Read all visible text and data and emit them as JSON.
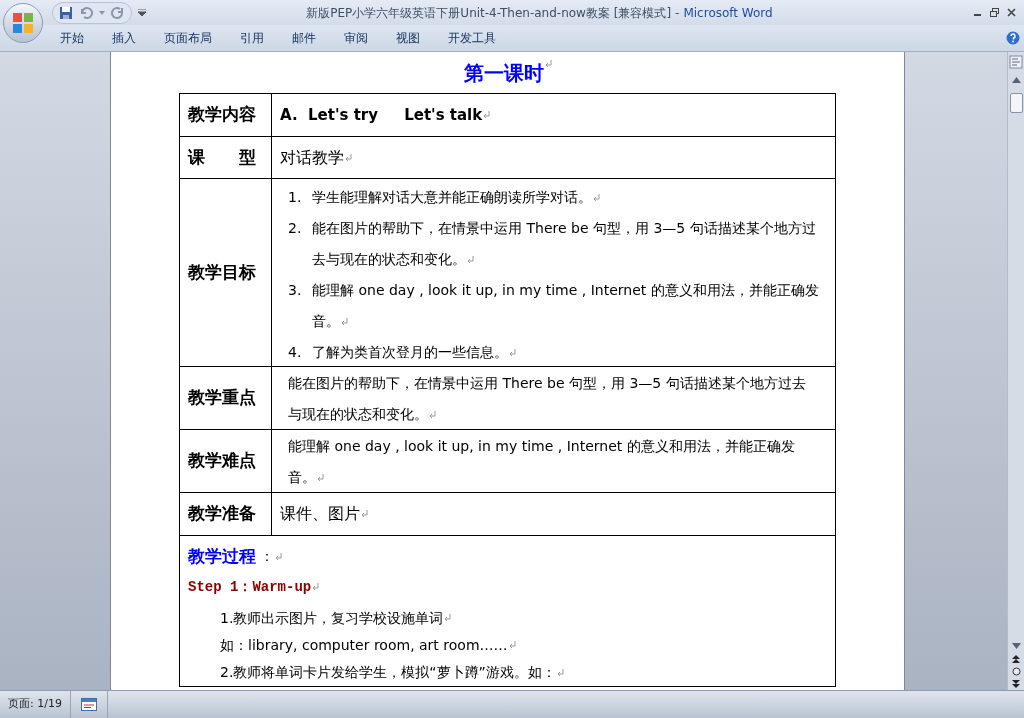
{
  "window": {
    "document_title": "新版PEP小学六年级英语下册Unit-4-Then-and-now教案 [兼容模式]",
    "separator": "-",
    "app_name": "Microsoft Word"
  },
  "ribbon_tabs": [
    "开始",
    "插入",
    "页面布局",
    "引用",
    "邮件",
    "审阅",
    "视图",
    "开发工具"
  ],
  "document": {
    "heading": "第一课时",
    "rows": [
      {
        "label": "教学内容",
        "kind": "title",
        "parts": [
          "A.",
          "Let's try",
          "Let's talk"
        ]
      },
      {
        "label": "课　　型",
        "kind": "text",
        "text": "对话教学"
      },
      {
        "label": "教学目标",
        "kind": "numbered",
        "items": [
          {
            "number": "1.",
            "text": "学生能理解对话大意并能正确朗读所学对话。"
          },
          {
            "number": "2.",
            "text": "能在图片的帮助下，在情景中运用 There be 句型，用 3—5 句话描述某个地方过去与现在的状态和变化。"
          },
          {
            "number": "3.",
            "text": "能理解 one day , look it up, in my time , Internet 的意义和用法，并能正确发音。"
          },
          {
            "number": "4.",
            "text": "了解为类首次登月的一些信息。"
          }
        ]
      },
      {
        "label": "教学重点",
        "kind": "paragraph",
        "text": "能在图片的帮助下，在情景中运用 There be 句型，用 3—5 句话描述某个地方过去与现在的状态和变化。"
      },
      {
        "label": "教学难点",
        "kind": "paragraph",
        "text": "能理解 one day , look it up, in my time , Internet 的意义和用法，并能正确发音。"
      },
      {
        "label": "教学准备",
        "kind": "text",
        "text": "课件、图片"
      }
    ],
    "process": {
      "heading": "教学过程",
      "colon": "：",
      "step": "Step 1：Warm-up",
      "lines": [
        "1.教师出示图片，复习学校设施单词",
        "如：library, computer room, art room……",
        "2.教师将单词卡片发给学生，模拟“萝卜蹲”游戏。如："
      ]
    }
  },
  "status_bar": {
    "page": "页面: 1/19"
  }
}
